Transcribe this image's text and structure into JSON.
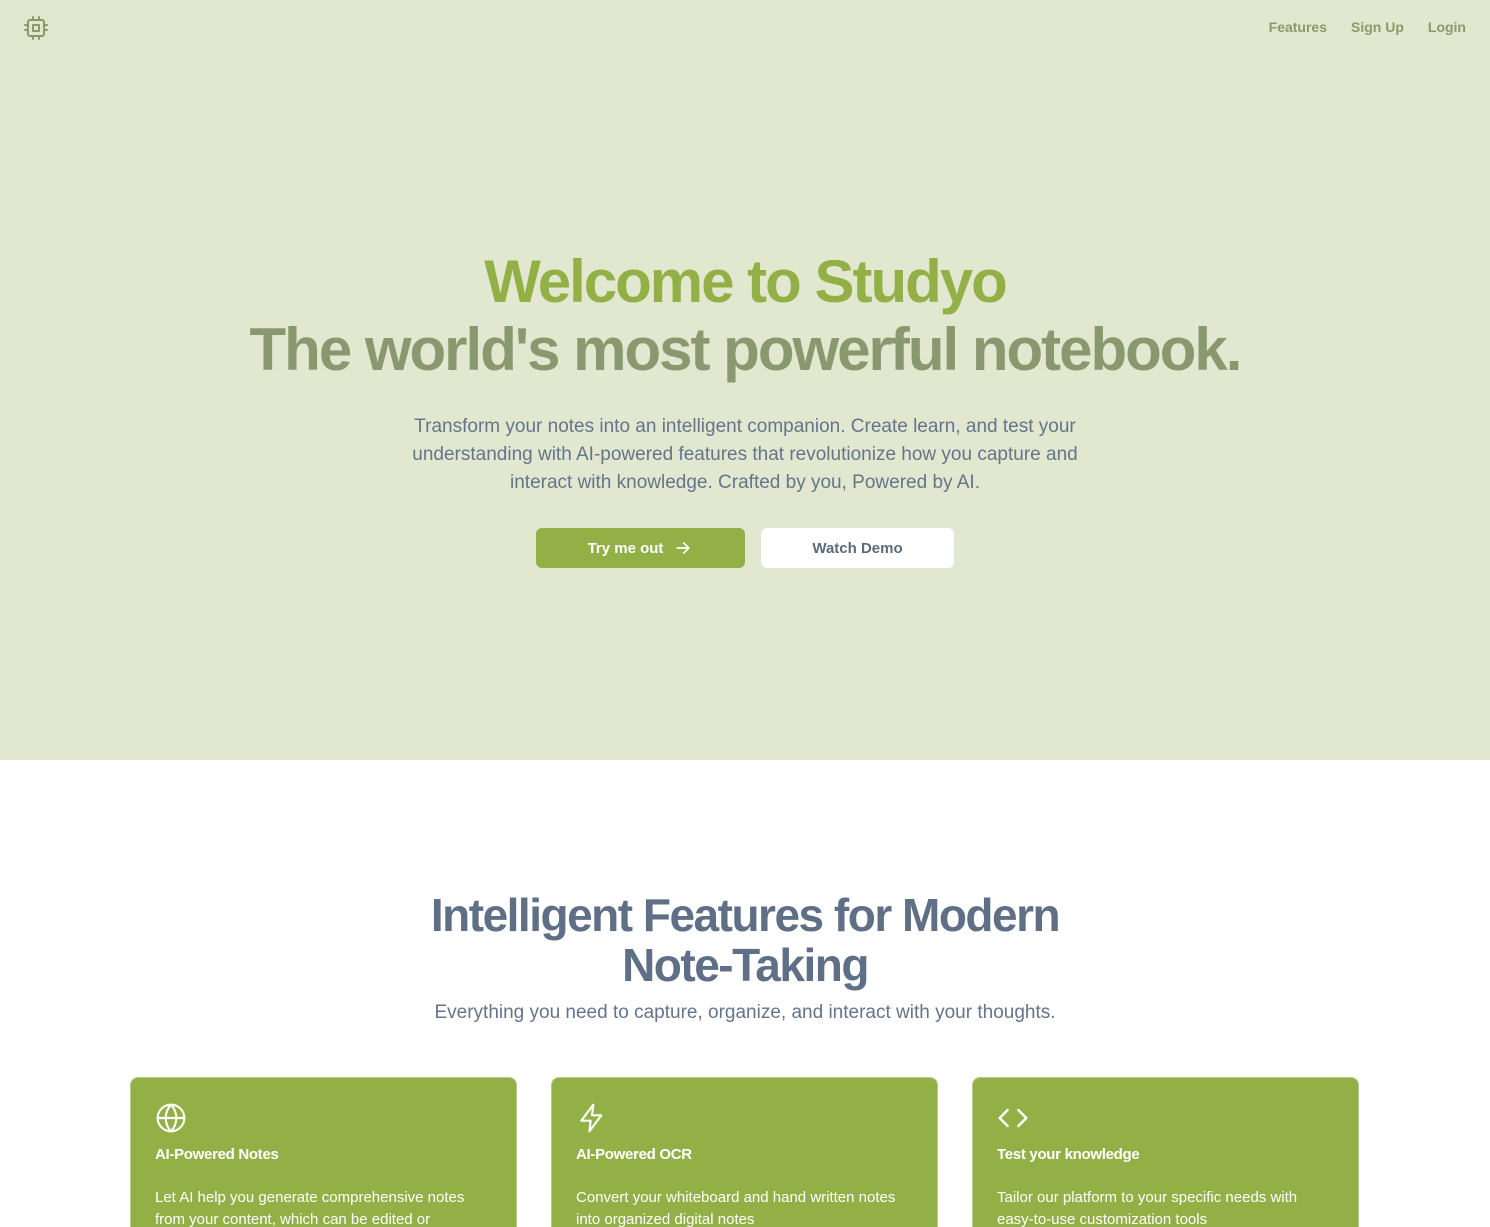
{
  "nav": {
    "items": [
      {
        "label": "Features"
      },
      {
        "label": "Sign Up"
      },
      {
        "label": "Login"
      }
    ]
  },
  "hero": {
    "title_line1": "Welcome to Studyo",
    "title_line2": "The world's most powerful notebook.",
    "subtitle": "Transform your notes into an intelligent companion. Create learn, and test your understanding with AI-powered features that revolutionize how you capture and interact with knowledge. Crafted by you, Powered by AI.",
    "primary_button": "Try me out",
    "secondary_button": "Watch Demo"
  },
  "features": {
    "title_line1": "Intelligent Features for Modern",
    "title_line2": "Note-Taking",
    "subtitle": "Everything you need to capture, organize, and interact with your thoughts.",
    "cards": [
      {
        "icon": "globe-icon",
        "title": "AI-Powered Notes",
        "text": "Let AI help you generate comprehensive notes from your content, which can be edited or"
      },
      {
        "icon": "lightning-icon",
        "title": "AI-Powered OCR",
        "text": "Convert your whiteboard and hand written notes into organized digital notes"
      },
      {
        "icon": "code-icon",
        "title": "Test your knowledge",
        "text": "Tailor our platform to your specific needs with easy-to-use customization tools"
      }
    ]
  },
  "colors": {
    "hero_bg": "#e2e8cf",
    "accent": "#93b047",
    "title_secondary": "#8a9870",
    "heading": "#5f6f86"
  }
}
